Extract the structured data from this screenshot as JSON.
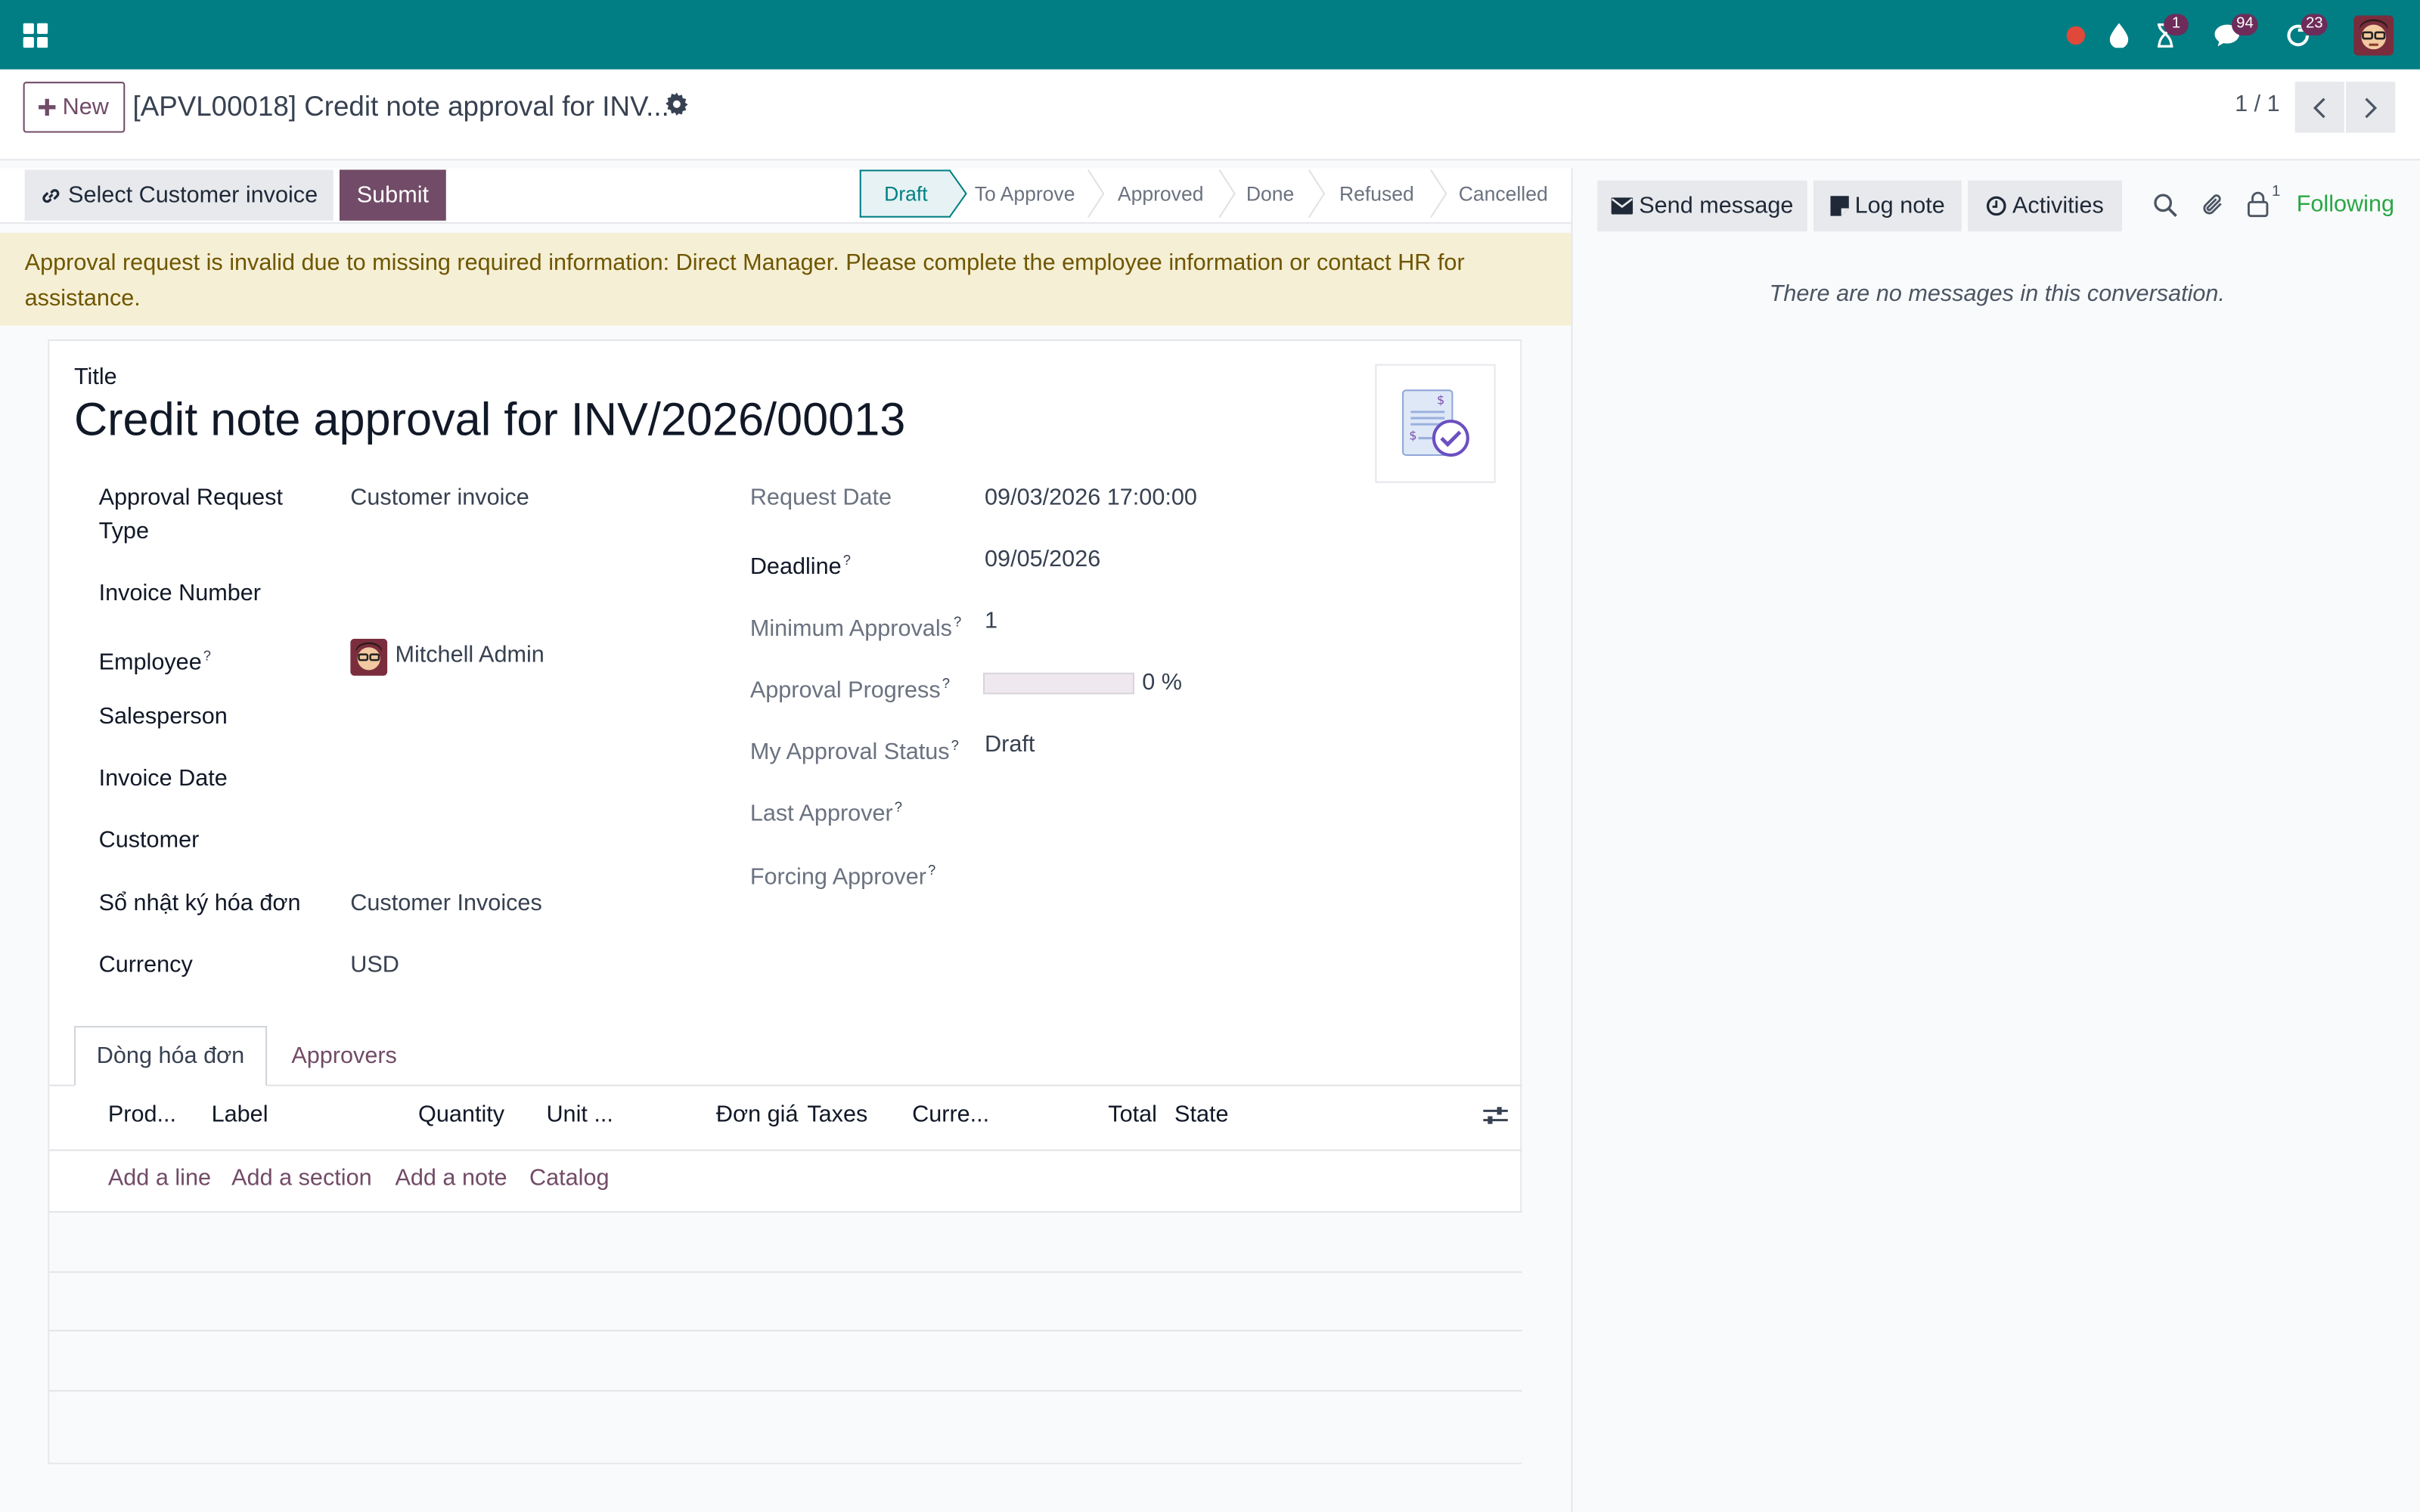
{
  "navbar": {
    "background": "#017e84",
    "activity_badge": "1",
    "discuss_badge": "94",
    "timer_badge": "23"
  },
  "control_panel": {
    "new_label": "New",
    "record_title": "[APVL00018] Credit note approval for INV...",
    "pager": "1 / 1"
  },
  "statusbar": {
    "select_invoice_label": "Select Customer invoice",
    "submit_label": "Submit",
    "stages": [
      "Draft",
      "To Approve",
      "Approved",
      "Done",
      "Refused",
      "Cancelled"
    ],
    "active_stage": "Draft"
  },
  "warning": {
    "text": "Approval request is invalid due to missing required information: Direct Manager. Please complete the employee information or contact HR for assistance."
  },
  "form": {
    "title_label": "Title",
    "title": "Credit note approval for INV/2026/00013",
    "left_fields": {
      "approval_request_type": {
        "label": "Approval Request Type",
        "value": "Customer invoice"
      },
      "invoice_number": {
        "label": "Invoice Number",
        "value": ""
      },
      "employee": {
        "label": "Employee",
        "value": "Mitchell Admin"
      },
      "salesperson": {
        "label": "Salesperson",
        "value": ""
      },
      "invoice_date": {
        "label": "Invoice Date",
        "value": ""
      },
      "customer": {
        "label": "Customer",
        "value": ""
      },
      "journal": {
        "label": "Sổ nhật ký hóa đơn",
        "value": "Customer Invoices"
      },
      "currency": {
        "label": "Currency",
        "value": "USD"
      }
    },
    "right_fields": {
      "request_date": {
        "label": "Request Date",
        "value": "09/03/2026 17:00:00"
      },
      "deadline": {
        "label": "Deadline",
        "value": "09/05/2026"
      },
      "minimum_approvals": {
        "label": "Minimum Approvals",
        "value": "1"
      },
      "approval_progress": {
        "label": "Approval Progress",
        "value": "0 %",
        "fraction": 0
      },
      "my_approval_status": {
        "label": "My Approval Status",
        "value": "Draft"
      },
      "last_approver": {
        "label": "Last Approver",
        "value": ""
      },
      "forcing_approver": {
        "label": "Forcing Approver",
        "value": ""
      }
    },
    "help_mark": "?",
    "tabs": [
      "Dòng hóa đơn",
      "Approvers"
    ],
    "lines_table": {
      "columns": [
        "Prod...",
        "Label",
        "Quantity",
        "Unit ...",
        "Đơn giá",
        "Taxes",
        "Curre...",
        "Total",
        "State"
      ],
      "add_links": [
        "Add a line",
        "Add a section",
        "Add a note",
        "Catalog"
      ]
    }
  },
  "chatter": {
    "send_message_label": "Send message",
    "log_note_label": "Log note",
    "activities_label": "Activities",
    "followers_count": "1",
    "following_label": "Following",
    "empty_text": "There are no messages in this conversation."
  },
  "colors": {
    "brand_primary": "#714b67",
    "teal": "#017e84",
    "following_green": "#28a745",
    "warning_bg": "#f5efd5"
  }
}
